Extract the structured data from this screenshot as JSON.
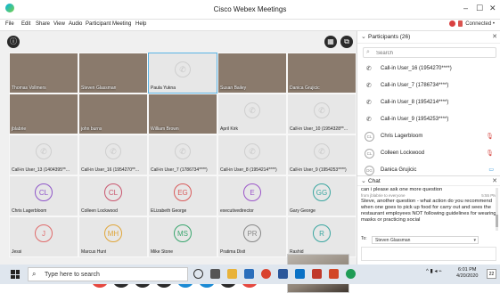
{
  "window": {
    "title": "Cisco Webex Meetings",
    "controls": {
      "minimize": "–",
      "maximize": "☐",
      "close": "✕"
    }
  },
  "menu": [
    "File",
    "Edit",
    "Share",
    "View",
    "Audio",
    "Participant",
    "Meeting",
    "Help"
  ],
  "status": {
    "connection": "Connected •"
  },
  "grid_tiles": [
    {
      "name": "Thomas Vollmers",
      "type": "video"
    },
    {
      "name": "Steven Glassman",
      "type": "video"
    },
    {
      "name": "Paula Yukna",
      "type": "phone"
    },
    {
      "name": "Susan Bailey",
      "type": "video"
    },
    {
      "name": "Danica Grujicic",
      "type": "video"
    },
    {
      "name": "jblabrie",
      "type": "video"
    },
    {
      "name": "john burns",
      "type": "video"
    },
    {
      "name": "William Brown",
      "type": "video"
    },
    {
      "name": "April Kirk",
      "type": "phone"
    },
    {
      "name": "Call-in User_10 (1954328**...",
      "type": "phone"
    },
    {
      "name": "Call-in User_13 (1404395**...",
      "type": "phone"
    },
    {
      "name": "Call-in User_16 (1954270**...",
      "type": "phone"
    },
    {
      "name": "Call-in User_7 (1786734****)",
      "type": "phone"
    },
    {
      "name": "Call-in User_8 (1954214****)",
      "type": "phone"
    },
    {
      "name": "Call-in User_9 (1954253****)",
      "type": "phone"
    },
    {
      "name": "Chris Lagerbloom",
      "type": "initials",
      "initials": "CL",
      "color": "#8f56c9"
    },
    {
      "name": "Colleen Lockwood",
      "type": "initials",
      "initials": "CL",
      "color": "#c9566e"
    },
    {
      "name": "ELizabeth George",
      "type": "initials",
      "initials": "EG",
      "color": "#d95b5b"
    },
    {
      "name": "executivedirector",
      "type": "initials",
      "initials": "E",
      "color": "#9b56c9"
    },
    {
      "name": "Gary George",
      "type": "initials",
      "initials": "GG",
      "color": "#3aa6a0"
    },
    {
      "name": "Jessi",
      "type": "initials",
      "initials": "J",
      "color": "#e06b6b"
    },
    {
      "name": "Marcus Hunt",
      "type": "initials",
      "initials": "MH",
      "color": "#e0a63a"
    },
    {
      "name": "Mike Stone",
      "type": "initials",
      "initials": "MS",
      "color": "#3aa66e"
    },
    {
      "name": "Pratima Dixit",
      "type": "initials",
      "initials": "PR",
      "color": "#888888"
    },
    {
      "name": "Rashid",
      "type": "initials",
      "initials": "R",
      "color": "#3aa6a0"
    }
  ],
  "participants_panel": {
    "title": "Participants (26)",
    "search_placeholder": "Search",
    "items": [
      {
        "name": "Call-in User_16 (1954270****)",
        "kind": "phone"
      },
      {
        "name": "Call-in User_7 (1786734****)",
        "kind": "phone"
      },
      {
        "name": "Call-in User_8 (1954214****)",
        "kind": "phone"
      },
      {
        "name": "Call-in User_9 (1954253****)",
        "kind": "phone"
      },
      {
        "name": "Chris Lagerbloom",
        "kind": "avatar",
        "initials": "CL"
      },
      {
        "name": "Colleen Lockwood",
        "kind": "avatar",
        "initials": "CL"
      },
      {
        "name": "Danica Grujicic",
        "kind": "avatar",
        "initials": "DG"
      }
    ]
  },
  "chat": {
    "title": "Chat",
    "first_line": "can i please ask one more question",
    "from": "from jblabrie to everyone",
    "time": "5:55 PM",
    "message": "Steve, another question - what action do you recommend when one goes to pick up food for carry out and sees the restaurant employees NOT following guidelines for wearing masks or practicing social",
    "to_label": "To:",
    "to_value": "Steven Glassman"
  },
  "taskbar": {
    "search_placeholder": "Type here to search",
    "time": "6:01 PM",
    "date": "4/20/2020",
    "notifications": "22"
  }
}
